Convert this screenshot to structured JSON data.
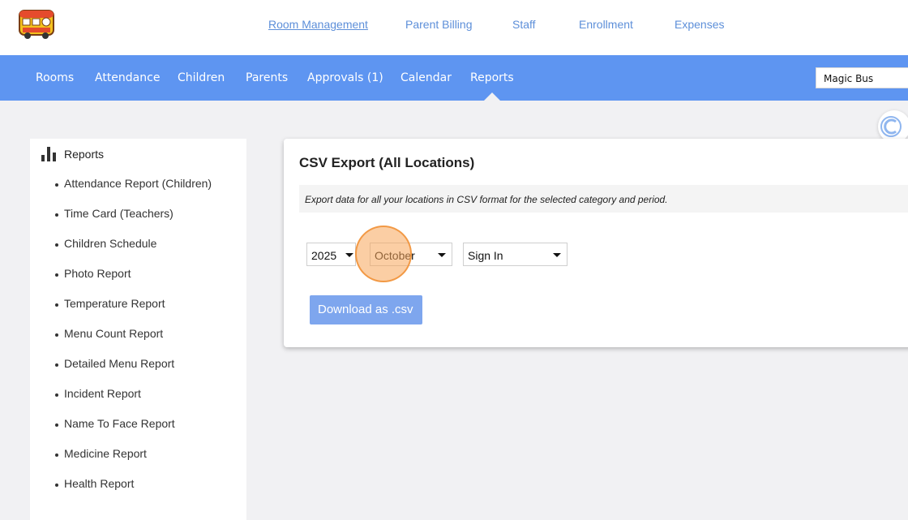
{
  "top_nav": {
    "items": [
      {
        "label": "Room Management",
        "active": true
      },
      {
        "label": "Parent Billing",
        "active": false
      },
      {
        "label": "Staff",
        "active": false
      },
      {
        "label": "Enrollment",
        "active": false
      },
      {
        "label": "Expenses",
        "active": false
      }
    ]
  },
  "main_nav": {
    "items": [
      {
        "label": "Rooms"
      },
      {
        "label": "Attendance"
      },
      {
        "label": "Children"
      },
      {
        "label": "Parents"
      },
      {
        "label": "Approvals (1)"
      },
      {
        "label": "Calendar"
      },
      {
        "label": "Reports",
        "active": true
      }
    ],
    "account": "Magic Bus"
  },
  "sidebar": {
    "title": "Reports",
    "title_icon": "bar-chart-icon",
    "items": [
      "Attendance Report (Children)",
      "Time Card (Teachers)",
      "Children Schedule",
      "Photo Report",
      "Temperature Report",
      "Menu Count Report",
      "Detailed Menu Report",
      "Incident Report",
      "Name To Face Report",
      "Medicine Report",
      "Health Report"
    ]
  },
  "panel": {
    "title": "CSV Export (All Locations)",
    "description": "Export data for all your locations in CSV format for the selected category and period.",
    "year": "2025",
    "month": "October",
    "category": "Sign In",
    "download_label": "Download as .csv"
  },
  "colors": {
    "nav_bg": "#5e95f1",
    "link": "#5d8fd9",
    "button": "#7ea6ee",
    "highlight": "#f7a659"
  }
}
